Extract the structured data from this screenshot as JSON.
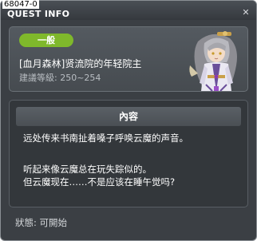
{
  "window": {
    "id_label": "68047-0",
    "title": "QUEST INFO",
    "close_glyph": "✕"
  },
  "quest": {
    "category": "一般",
    "name": "[血月森林]贤流院的年轻院主",
    "level": "建議等級: 250~254"
  },
  "content": {
    "header": "內容",
    "lines": [
      "远处传来书南扯着嗓子呼唤云魔的声音。",
      "听起来像云魔总在玩失踪似的。",
      "但云魔现在……不是应该在睡午觉吗?"
    ]
  },
  "status": "狀態: 可開始",
  "colors": {
    "badge": "#7fb82b",
    "panel": "#3b3f44"
  },
  "icons": {
    "close": "close-icon",
    "portrait": "npc-portrait"
  }
}
